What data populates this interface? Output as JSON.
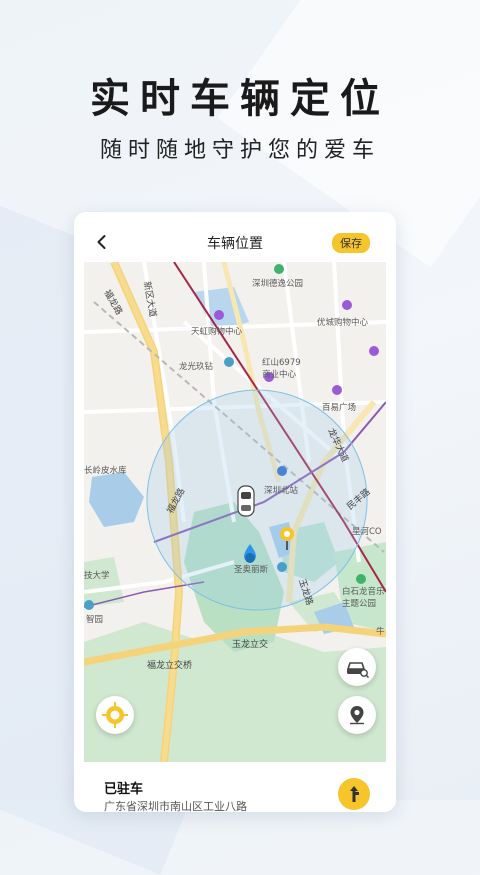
{
  "hero": {
    "title": "实时车辆定位",
    "subtitle": "随时随地守护您的爱车"
  },
  "app": {
    "nav_title": "车辆位置",
    "save_label": "保存",
    "accent_color": "#f6c42b"
  },
  "map": {
    "roads": {
      "fulong_road_north": "福龙路",
      "fulong_road_south": "福龙路",
      "xinqu_avenue": "新区大道",
      "longhua_avenue": "龙华大道",
      "minfeng_road": "民丰路",
      "yulong_road": "玉龙路",
      "yulong_interchange": "玉龙立交",
      "fulong_interchange": "福龙立交桥"
    },
    "pois": {
      "park": "深圳德逸公园",
      "tianhong": "天虹购物中心",
      "youcheng": "优城购物中心",
      "longguang": "龙光玖钻",
      "hongshan": "红山6979",
      "hongshan_sub": "商业中心",
      "baiyi": "百易广场",
      "changling": "长岭皮水库",
      "shenzhen_north": "深圳北站",
      "xinghe": "星河CO",
      "shengaolisi": "圣奥丽斯",
      "bailonglong": "白石龙音乐",
      "bailonglong_sub": "主题公园",
      "daxue": "技大学",
      "zhiyuan": "智园",
      "niu": "牛"
    }
  },
  "vehicle": {
    "status": "已驻车",
    "address": "广东省深圳市南山区工业八路"
  },
  "icons": {
    "back": "chevron-left-icon",
    "car_search": "car-search-icon",
    "location": "location-pin-icon",
    "locate": "locate-target-icon",
    "navigate": "navigation-arrow-icon"
  }
}
